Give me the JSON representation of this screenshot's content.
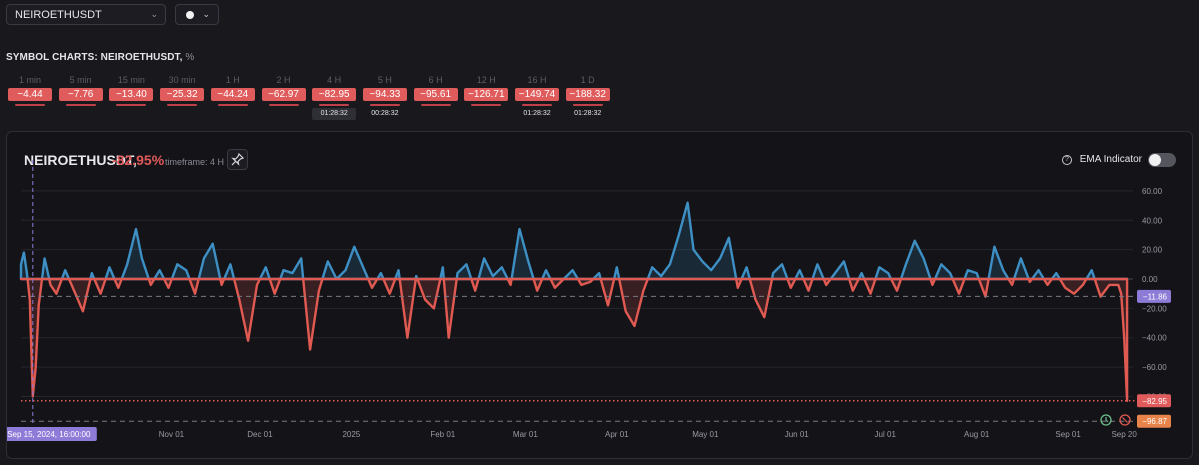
{
  "symbol_select": {
    "value": "NEIROETHUSDT"
  },
  "section": {
    "title": "SYMBOL CHARTS: NEIROETHUSDT,",
    "unit": "%"
  },
  "timeframes": [
    {
      "label": "1 min",
      "value": "−4.44",
      "timer": ""
    },
    {
      "label": "5 min",
      "value": "−7.76",
      "timer": ""
    },
    {
      "label": "15 min",
      "value": "−13.40",
      "timer": ""
    },
    {
      "label": "30 min",
      "value": "−25.32",
      "timer": ""
    },
    {
      "label": "1 H",
      "value": "−44.24",
      "timer": ""
    },
    {
      "label": "2 H",
      "value": "−62.97",
      "timer": ""
    },
    {
      "label": "4 H",
      "value": "−82.95",
      "timer": "01:28:32"
    },
    {
      "label": "5 H",
      "value": "−94.33",
      "timer": "00:28:32"
    },
    {
      "label": "6 H",
      "value": "−95.61",
      "timer": ""
    },
    {
      "label": "12 H",
      "value": "−126.71",
      "timer": ""
    },
    {
      "label": "16 H",
      "value": "−149.74",
      "timer": "01:28:32"
    },
    {
      "label": "1 D",
      "value": "−188.32",
      "timer": "01:28:32"
    }
  ],
  "chart_header": {
    "symbol": "NEIROETHUSDT,",
    "change": "-82.95%",
    "timeframe": "timeframe: 4 H",
    "ema_label": "EMA Indicator",
    "ema_enabled": false
  },
  "colors": {
    "positive": "#3d8fc4",
    "negative": "#e05a52",
    "badge": "#e05c5c",
    "accent": "#8e7bd8"
  },
  "chart_data": {
    "type": "area",
    "xlabel": "",
    "ylabel": "",
    "ylim": [
      -96.87,
      60
    ],
    "y_ticks": [
      60,
      40,
      20,
      0,
      -20,
      -40,
      -60,
      -80
    ],
    "y_tick_labels": [
      "60.00",
      "40.00",
      "20.00",
      "0.00",
      "−20.00",
      "−40.00",
      "−60.00",
      "−80.00"
    ],
    "x_ticks": [
      {
        "date": "2024-11-01",
        "label": "Nov 01"
      },
      {
        "date": "2024-12-01",
        "label": "Dec 01"
      },
      {
        "date": "2025-01-01",
        "label": "2025"
      },
      {
        "date": "2025-02-01",
        "label": "Feb 01"
      },
      {
        "date": "2025-03-01",
        "label": "Mar 01"
      },
      {
        "date": "2025-04-01",
        "label": "Apr 01"
      },
      {
        "date": "2025-05-01",
        "label": "May 01"
      },
      {
        "date": "2025-06-01",
        "label": "Jun 01"
      },
      {
        "date": "2025-07-01",
        "label": "Jul 01"
      },
      {
        "date": "2025-08-01",
        "label": "Aug 01"
      },
      {
        "date": "2025-09-01",
        "label": "Sep 01"
      },
      {
        "date": "2025-09-20",
        "label": "Sep 20"
      }
    ],
    "x_range": [
      "2024-09-11",
      "2025-09-23"
    ],
    "crosshair_label": "Sep 15, 2024, 16:00:00",
    "crosshair_date": "2024-09-15",
    "badges": [
      {
        "value": -11.86,
        "label": "−11.86",
        "color": "#8e7bd8",
        "line": "dashed-gray"
      },
      {
        "value": -82.95,
        "label": "−82.95",
        "color": "#e05c5c",
        "line": "dotted-red"
      },
      {
        "value": -96.87,
        "label": "−96.87",
        "color": "#e8844a",
        "line": "dashed-gray"
      }
    ],
    "series": [
      {
        "points": [
          [
            "2024-09-11",
            10
          ],
          [
            "2024-09-12",
            18
          ],
          [
            "2024-09-13",
            4
          ],
          [
            "2024-09-14",
            -14
          ],
          [
            "2024-09-15",
            -80
          ],
          [
            "2024-09-16",
            -60
          ],
          [
            "2024-09-17",
            -18
          ],
          [
            "2024-09-19",
            14
          ],
          [
            "2024-09-21",
            -4
          ],
          [
            "2024-09-23",
            -10
          ],
          [
            "2024-09-26",
            6
          ],
          [
            "2024-09-29",
            -8
          ],
          [
            "2024-10-02",
            -22
          ],
          [
            "2024-10-05",
            4
          ],
          [
            "2024-10-08",
            -10
          ],
          [
            "2024-10-11",
            8
          ],
          [
            "2024-10-14",
            -6
          ],
          [
            "2024-10-17",
            10
          ],
          [
            "2024-10-20",
            34
          ],
          [
            "2024-10-22",
            14
          ],
          [
            "2024-10-25",
            -4
          ],
          [
            "2024-10-28",
            6
          ],
          [
            "2024-10-31",
            -6
          ],
          [
            "2024-11-03",
            10
          ],
          [
            "2024-11-06",
            6
          ],
          [
            "2024-11-09",
            -10
          ],
          [
            "2024-11-12",
            14
          ],
          [
            "2024-11-15",
            24
          ],
          [
            "2024-11-18",
            -4
          ],
          [
            "2024-11-21",
            10
          ],
          [
            "2024-11-24",
            -14
          ],
          [
            "2024-11-27",
            -42
          ],
          [
            "2024-11-30",
            -4
          ],
          [
            "2024-12-03",
            8
          ],
          [
            "2024-12-06",
            -10
          ],
          [
            "2024-12-09",
            6
          ],
          [
            "2024-12-12",
            4
          ],
          [
            "2024-12-15",
            14
          ],
          [
            "2024-12-18",
            -48
          ],
          [
            "2024-12-21",
            -8
          ],
          [
            "2024-12-24",
            12
          ],
          [
            "2024-12-27",
            0
          ],
          [
            "2024-12-30",
            6
          ],
          [
            "2025-01-02",
            22
          ],
          [
            "2025-01-05",
            8
          ],
          [
            "2025-01-08",
            -6
          ],
          [
            "2025-01-11",
            4
          ],
          [
            "2025-01-14",
            -10
          ],
          [
            "2025-01-17",
            6
          ],
          [
            "2025-01-20",
            -40
          ],
          [
            "2025-01-23",
            2
          ],
          [
            "2025-01-26",
            -14
          ],
          [
            "2025-01-29",
            -20
          ],
          [
            "2025-02-01",
            8
          ],
          [
            "2025-02-03",
            -40
          ],
          [
            "2025-02-06",
            4
          ],
          [
            "2025-02-09",
            10
          ],
          [
            "2025-02-12",
            -8
          ],
          [
            "2025-02-15",
            14
          ],
          [
            "2025-02-18",
            2
          ],
          [
            "2025-02-21",
            8
          ],
          [
            "2025-02-24",
            -4
          ],
          [
            "2025-02-27",
            34
          ],
          [
            "2025-03-02",
            12
          ],
          [
            "2025-03-05",
            -8
          ],
          [
            "2025-03-08",
            6
          ],
          [
            "2025-03-11",
            -6
          ],
          [
            "2025-03-14",
            0
          ],
          [
            "2025-03-17",
            6
          ],
          [
            "2025-03-20",
            -4
          ],
          [
            "2025-03-23",
            -2
          ],
          [
            "2025-03-26",
            4
          ],
          [
            "2025-03-29",
            -18
          ],
          [
            "2025-04-01",
            8
          ],
          [
            "2025-04-04",
            -22
          ],
          [
            "2025-04-07",
            -32
          ],
          [
            "2025-04-10",
            -8
          ],
          [
            "2025-04-13",
            8
          ],
          [
            "2025-04-16",
            2
          ],
          [
            "2025-04-19",
            10
          ],
          [
            "2025-04-22",
            30
          ],
          [
            "2025-04-25",
            52
          ],
          [
            "2025-04-27",
            20
          ],
          [
            "2025-04-30",
            12
          ],
          [
            "2025-05-03",
            6
          ],
          [
            "2025-05-06",
            14
          ],
          [
            "2025-05-09",
            28
          ],
          [
            "2025-05-12",
            -6
          ],
          [
            "2025-05-15",
            8
          ],
          [
            "2025-05-18",
            -14
          ],
          [
            "2025-05-21",
            -26
          ],
          [
            "2025-05-24",
            4
          ],
          [
            "2025-05-27",
            10
          ],
          [
            "2025-05-30",
            -6
          ],
          [
            "2025-06-02",
            6
          ],
          [
            "2025-06-05",
            -8
          ],
          [
            "2025-06-08",
            10
          ],
          [
            "2025-06-11",
            -4
          ],
          [
            "2025-06-14",
            4
          ],
          [
            "2025-06-17",
            12
          ],
          [
            "2025-06-20",
            -8
          ],
          [
            "2025-06-23",
            4
          ],
          [
            "2025-06-26",
            -10
          ],
          [
            "2025-06-29",
            8
          ],
          [
            "2025-07-02",
            4
          ],
          [
            "2025-07-05",
            -8
          ],
          [
            "2025-07-08",
            10
          ],
          [
            "2025-07-11",
            26
          ],
          [
            "2025-07-14",
            14
          ],
          [
            "2025-07-17",
            -4
          ],
          [
            "2025-07-20",
            10
          ],
          [
            "2025-07-23",
            4
          ],
          [
            "2025-07-26",
            -10
          ],
          [
            "2025-07-29",
            6
          ],
          [
            "2025-08-01",
            4
          ],
          [
            "2025-08-04",
            -12
          ],
          [
            "2025-08-07",
            22
          ],
          [
            "2025-08-10",
            6
          ],
          [
            "2025-08-13",
            -4
          ],
          [
            "2025-08-16",
            14
          ],
          [
            "2025-08-19",
            -2
          ],
          [
            "2025-08-22",
            6
          ],
          [
            "2025-08-25",
            -4
          ],
          [
            "2025-08-28",
            4
          ],
          [
            "2025-08-31",
            -6
          ],
          [
            "2025-09-03",
            -10
          ],
          [
            "2025-09-06",
            -4
          ],
          [
            "2025-09-09",
            6
          ],
          [
            "2025-09-12",
            -12
          ],
          [
            "2025-09-15",
            -4
          ],
          [
            "2025-09-18",
            -4
          ],
          [
            "2025-09-19",
            -10
          ],
          [
            "2025-09-20",
            -40
          ],
          [
            "2025-09-21",
            -82.95
          ]
        ]
      }
    ]
  }
}
